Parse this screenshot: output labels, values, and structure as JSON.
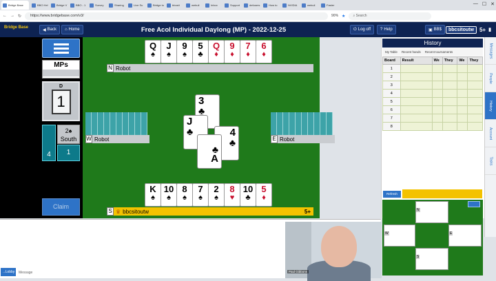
{
  "browser": {
    "tabs": [
      "Bridge Base",
      "BBO Hel",
      "Bridge V",
      "BBO - 1",
      "Survey",
      "Sharing",
      "Live Su",
      "Bridge to",
      "bbosit",
      "webuil",
      "Inbox",
      "Support",
      "defusers",
      "How to",
      "NVIDIA",
      "webuil",
      "Faster"
    ],
    "url": "https://www.bridgebase.com/v3/",
    "zoom": "90%",
    "search_placeholder": "Search"
  },
  "header": {
    "logo": "Bridge Base",
    "back_label": "Back",
    "home_label": "Home",
    "title": "Free Acol Individual Daylong (MP) - 2022-12-25",
    "logoff_label": "Log off",
    "help_label": "Help",
    "bbdollars_label": "BB$",
    "username": "bbcsitoutw",
    "rating": "5+"
  },
  "left": {
    "scoring": "MPs",
    "dealer_label": "D",
    "board_number": "1",
    "vul_left": "4",
    "contract": "2♠",
    "declarer": "South",
    "vul_right": "1",
    "claim_label": "Claim"
  },
  "table": {
    "north_name": "Robot",
    "west_name": "Robot",
    "east_name": "Robot",
    "south_name": "bbcsitoutw",
    "south_rating": "5+",
    "north_dir": "N",
    "west_dir": "W",
    "east_dir": "E",
    "south_dir": "S",
    "north_hand": [
      {
        "r": "Q",
        "s": "♠",
        "c": "blk"
      },
      {
        "r": "J",
        "s": "♠",
        "c": "blk"
      },
      {
        "r": "9",
        "s": "♠",
        "c": "blk"
      },
      {
        "r": "5",
        "s": "♣",
        "c": "blk"
      },
      {
        "r": "Q",
        "s": "♦",
        "c": "red"
      },
      {
        "r": "9",
        "s": "♦",
        "c": "red"
      },
      {
        "r": "7",
        "s": "♦",
        "c": "red"
      },
      {
        "r": "6",
        "s": "♦",
        "c": "red"
      }
    ],
    "south_hand": [
      {
        "r": "K",
        "s": "♠",
        "c": "blk"
      },
      {
        "r": "10",
        "s": "♠",
        "c": "blk"
      },
      {
        "r": "8",
        "s": "♠",
        "c": "blk"
      },
      {
        "r": "7",
        "s": "♠",
        "c": "blk"
      },
      {
        "r": "2",
        "s": "♠",
        "c": "blk"
      },
      {
        "r": "8",
        "s": "♥",
        "c": "red"
      },
      {
        "r": "10",
        "s": "♣",
        "c": "blk"
      },
      {
        "r": "5",
        "s": "♦",
        "c": "red"
      }
    ],
    "trick": {
      "north": {
        "r": "3",
        "s": "♣"
      },
      "west": {
        "r": "J",
        "s": "♣"
      },
      "east": {
        "r": "4",
        "s": "♣"
      },
      "south": {
        "r": "A",
        "s": "♣"
      }
    }
  },
  "history": {
    "title": "History",
    "tabs": [
      "My Table",
      "Recent hands",
      "Recent tournaments"
    ],
    "columns": [
      "Board",
      "Result",
      "We",
      "They",
      "We",
      "They"
    ],
    "boards": [
      "1",
      "2",
      "3",
      "4",
      "5",
      "6",
      "7",
      "8"
    ],
    "refresh_label": "Refresh",
    "mini_dirs": [
      "N",
      "W",
      "E",
      "S"
    ]
  },
  "sidetabs": [
    "Messages",
    "People",
    "History",
    "Account",
    "Tasks"
  ],
  "chat": {
    "lobby_label": "→Lobby",
    "message_label": "Message"
  },
  "video": {
    "name": "Paul Gibbons"
  }
}
